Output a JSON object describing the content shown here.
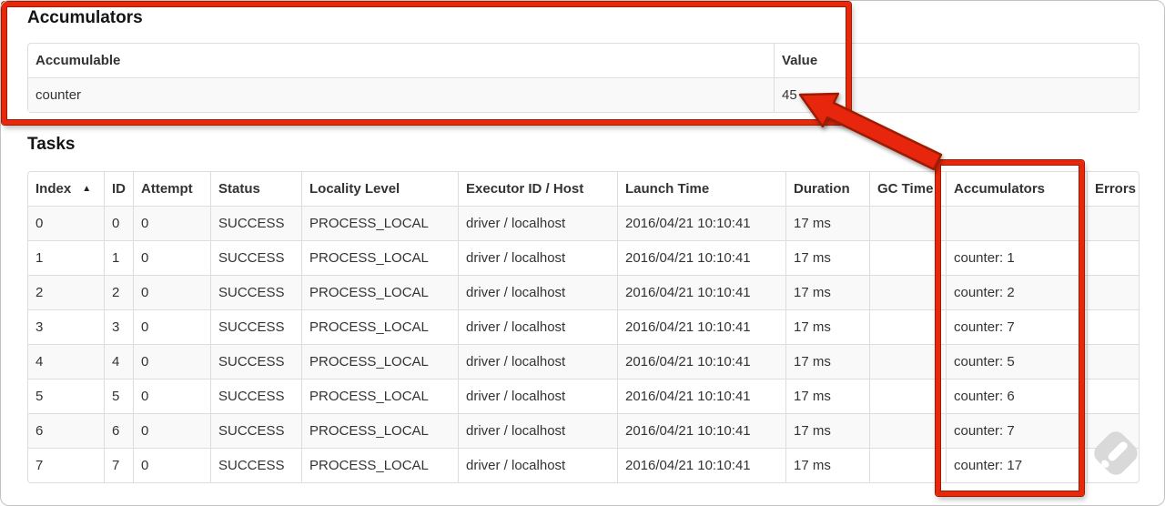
{
  "accumulators_section": {
    "title": "Accumulators",
    "table": {
      "headers": [
        "Accumulable",
        "Value"
      ],
      "rows": [
        [
          "counter",
          "45"
        ]
      ]
    }
  },
  "tasks_section": {
    "title": "Tasks",
    "table": {
      "headers": [
        "Index",
        "ID",
        "Attempt",
        "Status",
        "Locality Level",
        "Executor ID / Host",
        "Launch Time",
        "Duration",
        "GC Time",
        "Accumulators",
        "Errors"
      ],
      "sorted_by": "Index",
      "sort_direction": "ascending",
      "sort_icon": "▲",
      "rows": [
        [
          "0",
          "0",
          "0",
          "SUCCESS",
          "PROCESS_LOCAL",
          "driver / localhost",
          "2016/04/21 10:10:41",
          "17 ms",
          "",
          "",
          ""
        ],
        [
          "1",
          "1",
          "0",
          "SUCCESS",
          "PROCESS_LOCAL",
          "driver / localhost",
          "2016/04/21 10:10:41",
          "17 ms",
          "",
          "counter: 1",
          ""
        ],
        [
          "2",
          "2",
          "0",
          "SUCCESS",
          "PROCESS_LOCAL",
          "driver / localhost",
          "2016/04/21 10:10:41",
          "17 ms",
          "",
          "counter: 2",
          ""
        ],
        [
          "3",
          "3",
          "0",
          "SUCCESS",
          "PROCESS_LOCAL",
          "driver / localhost",
          "2016/04/21 10:10:41",
          "17 ms",
          "",
          "counter: 7",
          ""
        ],
        [
          "4",
          "4",
          "0",
          "SUCCESS",
          "PROCESS_LOCAL",
          "driver / localhost",
          "2016/04/21 10:10:41",
          "17 ms",
          "",
          "counter: 5",
          ""
        ],
        [
          "5",
          "5",
          "0",
          "SUCCESS",
          "PROCESS_LOCAL",
          "driver / localhost",
          "2016/04/21 10:10:41",
          "17 ms",
          "",
          "counter: 6",
          ""
        ],
        [
          "6",
          "6",
          "0",
          "SUCCESS",
          "PROCESS_LOCAL",
          "driver / localhost",
          "2016/04/21 10:10:41",
          "17 ms",
          "",
          "counter: 7",
          ""
        ],
        [
          "7",
          "7",
          "0",
          "SUCCESS",
          "PROCESS_LOCAL",
          "driver / localhost",
          "2016/04/21 10:10:41",
          "17 ms",
          "",
          "counter: 17",
          ""
        ]
      ]
    }
  },
  "annotations": {
    "highlight_color": "#e8270c",
    "outline_color": "#9b1d00",
    "boxes": [
      "accumulators-section",
      "accumulators-column"
    ],
    "arrow_target": "45"
  },
  "watermark": {
    "icon": "feedly-logo",
    "color": "#d9d9d9"
  }
}
